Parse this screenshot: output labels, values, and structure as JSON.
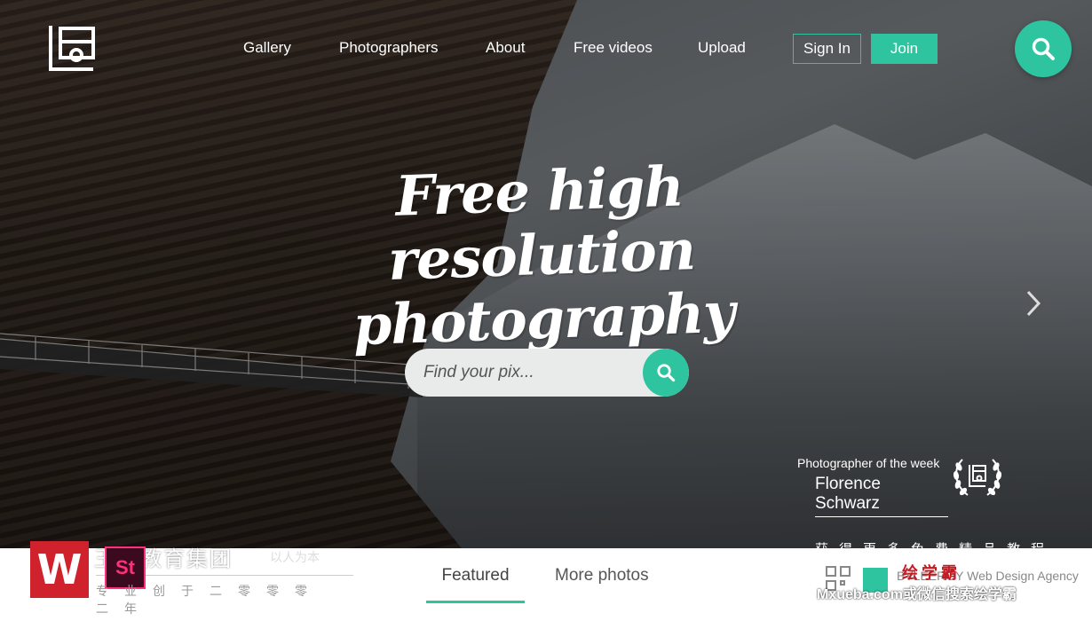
{
  "nav": {
    "links": [
      {
        "label": "Gallery"
      },
      {
        "label": "Photographers"
      },
      {
        "label": "About"
      },
      {
        "label": "Free videos"
      },
      {
        "label": "Upload"
      }
    ],
    "signin_label": "Sign In",
    "join_label": "Join"
  },
  "hero": {
    "headline_line1": "Free high resolution",
    "headline_line2": "photography"
  },
  "search": {
    "placeholder": "Find your pix..."
  },
  "photographer_of_week": {
    "label": "Photographer of the week",
    "name": "Florence Schwarz"
  },
  "tabs": [
    {
      "label": "Featured",
      "active": true
    },
    {
      "label": "More photos",
      "active": false
    }
  ],
  "watermark": {
    "left_title": "王氏教育集团",
    "left_sub": "以人为本",
    "left_row2": "专业创于二零零零二年",
    "right_top": "获得更多免费精品教程",
    "xueba": "绘学霸",
    "agency": "BYLEEROY Web Design Agency",
    "right_bottom": "Mxueba.com或微信搜索绘学霸"
  },
  "colors": {
    "accent": "#2ec4a0",
    "white": "#ffffff"
  }
}
